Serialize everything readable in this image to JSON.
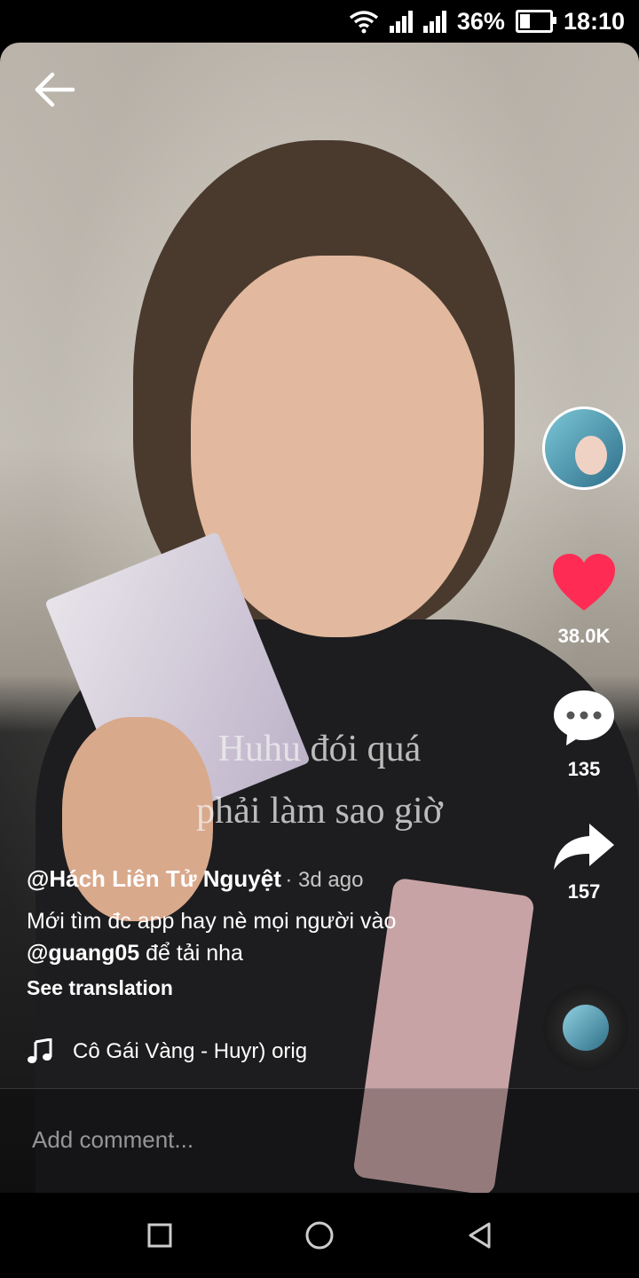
{
  "status_bar": {
    "battery": "36%",
    "battery_level": 0.36,
    "time": "18:10"
  },
  "video": {
    "overlay_lines": [
      "Huhu đói quá",
      "phải làm sao giờ"
    ]
  },
  "rail": {
    "likes": "38.0K",
    "comments": "135",
    "shares": "157",
    "like_color": "#fe2c55"
  },
  "caption": {
    "username": "@Hách Liên Tử Nguyệt",
    "time": "· 3d ago",
    "text_line1": "Mới tìm đc app hay nè mọi người vào",
    "mention": "@guang05",
    "text_line2": " để tải nha",
    "see_translation": "See translation"
  },
  "music": {
    "track": "Cô Gái Vàng - Huyr)     orig"
  },
  "comment": {
    "placeholder": "Add comment..."
  },
  "icons": [
    "back-arrow-icon",
    "wifi-icon",
    "signal-icon",
    "battery-icon",
    "heart-icon",
    "comment-icon",
    "share-icon",
    "music-note-icon",
    "recent-apps-icon",
    "home-icon",
    "back-triangle-icon"
  ]
}
